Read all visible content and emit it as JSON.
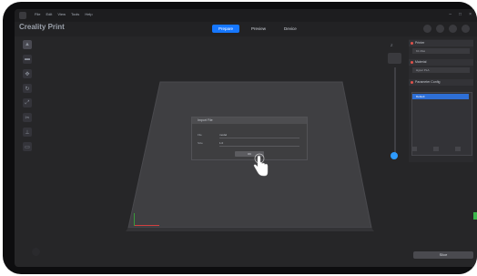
{
  "window": {
    "menu": [
      "File",
      "Edit",
      "View",
      "Tools",
      "Help"
    ],
    "controls": [
      "–",
      "□",
      "×"
    ]
  },
  "app": {
    "title": "Creality Print"
  },
  "tabs": [
    {
      "label": "Prepare",
      "active": true
    },
    {
      "label": "Preview",
      "active": false
    },
    {
      "label": "Device",
      "active": false
    }
  ],
  "left_tools": [
    {
      "icon": "add-object-icon"
    },
    {
      "icon": "add-plate-icon"
    },
    {
      "icon": "move-icon"
    },
    {
      "icon": "rotate-icon"
    },
    {
      "icon": "scale-icon"
    },
    {
      "icon": "cut-icon"
    },
    {
      "icon": "support-icon"
    },
    {
      "icon": "measure-icon"
    }
  ],
  "modal": {
    "title": "Import File",
    "rows": [
      {
        "label": "File",
        "value": "model"
      },
      {
        "label": "Size",
        "value": "1.0"
      }
    ],
    "button_label": "OK"
  },
  "zoom": {
    "label": "Z",
    "level": 0.95
  },
  "right_panel": {
    "sections": [
      {
        "title": "Printer",
        "row": "K1 Max"
      },
      {
        "title": "Material",
        "row": "Hyper PLA"
      },
      {
        "title": "Parameter Config",
        "row": ""
      }
    ],
    "list_item": "Default"
  },
  "slice_button": "Slice",
  "colors": {
    "accent": "#1677ff",
    "status_red": "#e0524b",
    "slider_knob": "#2e9bff",
    "axis_x": "#d24040",
    "axis_y": "#3a9a3a"
  }
}
